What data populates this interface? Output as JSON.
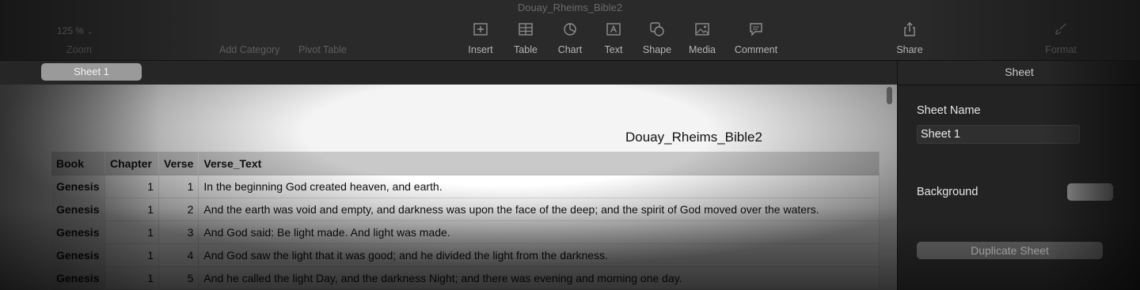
{
  "window": {
    "title": "Douay_Rheims_Bible2"
  },
  "toolbar": {
    "zoom_value": "125 %",
    "zoom_label": "Zoom",
    "add_category_label": "Add Category",
    "pivot_table_label": "Pivot Table",
    "insert_label": "Insert",
    "table_label": "Table",
    "chart_label": "Chart",
    "text_label": "Text",
    "shape_label": "Shape",
    "media_label": "Media",
    "comment_label": "Comment",
    "share_label": "Share",
    "format_label": "Format"
  },
  "tabs": [
    {
      "label": "Sheet 1"
    }
  ],
  "document": {
    "title": "Douay_Rheims_Bible2",
    "columns": [
      "Book",
      "Chapter",
      "Verse",
      "Verse_Text"
    ],
    "rows": [
      {
        "book": "Genesis",
        "chapter": "1",
        "verse": "1",
        "text": "In the beginning God created heaven, and earth."
      },
      {
        "book": "Genesis",
        "chapter": "1",
        "verse": "2",
        "text": "And the earth was void and empty, and darkness was upon the face of the deep; and the spirit of God moved over the waters."
      },
      {
        "book": "Genesis",
        "chapter": "1",
        "verse": "3",
        "text": "And God said: Be light made. And light was made."
      },
      {
        "book": "Genesis",
        "chapter": "1",
        "verse": "4",
        "text": "And God saw the light that it was good; and he divided the light from the darkness."
      },
      {
        "book": "Genesis",
        "chapter": "1",
        "verse": "5",
        "text": "And he called the light Day, and the darkness Night; and there was evening and morning one day."
      }
    ]
  },
  "inspector": {
    "header": "Sheet",
    "sheet_name_label": "Sheet Name",
    "sheet_name_value": "Sheet 1",
    "background_label": "Background",
    "duplicate_label": "Duplicate Sheet"
  }
}
